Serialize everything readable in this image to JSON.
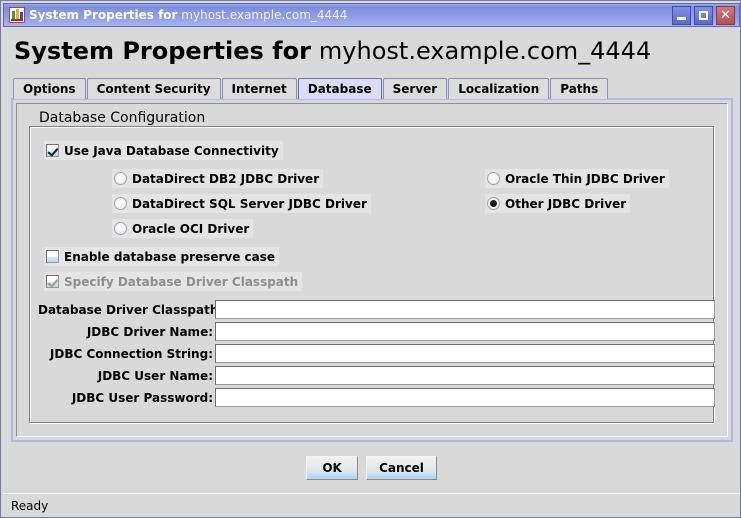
{
  "window": {
    "titlebar": {
      "icon": "java-app-icon",
      "title_strong": "System Properties for",
      "title_light": "myhost.example.com_4444",
      "minimize_label": "_",
      "maximize_label": "□",
      "close_label": "✕"
    },
    "header": {
      "strong": "System Properties for",
      "light": "myhost.example.com_4444"
    },
    "statusbar": {
      "text": "Ready"
    }
  },
  "tabs": [
    {
      "label": "Options",
      "selected": false
    },
    {
      "label": "Content Security",
      "selected": false
    },
    {
      "label": "Internet",
      "selected": false
    },
    {
      "label": "Database",
      "selected": true
    },
    {
      "label": "Server",
      "selected": false
    },
    {
      "label": "Localization",
      "selected": false
    },
    {
      "label": "Paths",
      "selected": false
    }
  ],
  "database_panel": {
    "group_title": "Database Configuration",
    "use_jdbc": {
      "label": "Use Java Database Connectivity",
      "checked": true,
      "enabled": true
    },
    "drivers_left": [
      {
        "label": "DataDirect DB2 JDBC Driver",
        "selected": false
      },
      {
        "label": "DataDirect SQL Server JDBC Driver",
        "selected": false
      },
      {
        "label": "Oracle OCI Driver",
        "selected": false
      }
    ],
    "drivers_right": [
      {
        "label": "Oracle Thin JDBC Driver",
        "selected": false
      },
      {
        "label": "Other JDBC Driver",
        "selected": true
      }
    ],
    "preserve_case": {
      "label": "Enable database preserve case",
      "checked": false,
      "enabled": true
    },
    "specify_classpath": {
      "label": "Specify Database Driver Classpath",
      "checked": true,
      "enabled": false
    },
    "fields": [
      {
        "label": "Database Driver Classpath:",
        "value": "",
        "placeholder": ""
      },
      {
        "label": "JDBC Driver Name:",
        "value": "",
        "placeholder": ""
      },
      {
        "label": "JDBC Connection String:",
        "value": "",
        "placeholder": ""
      },
      {
        "label": "JDBC User Name:",
        "value": "",
        "placeholder": ""
      },
      {
        "label": "JDBC User Password:",
        "value": "",
        "placeholder": ""
      }
    ]
  },
  "buttons": {
    "ok": "OK",
    "cancel": "Cancel"
  },
  "colors": {
    "titlebar_blue": "#8c9ce8",
    "selected_tab": "#dcdcf6",
    "panel_border": "#b6b6e6",
    "face": "#d9d9d9",
    "close_red": "#b85057"
  }
}
